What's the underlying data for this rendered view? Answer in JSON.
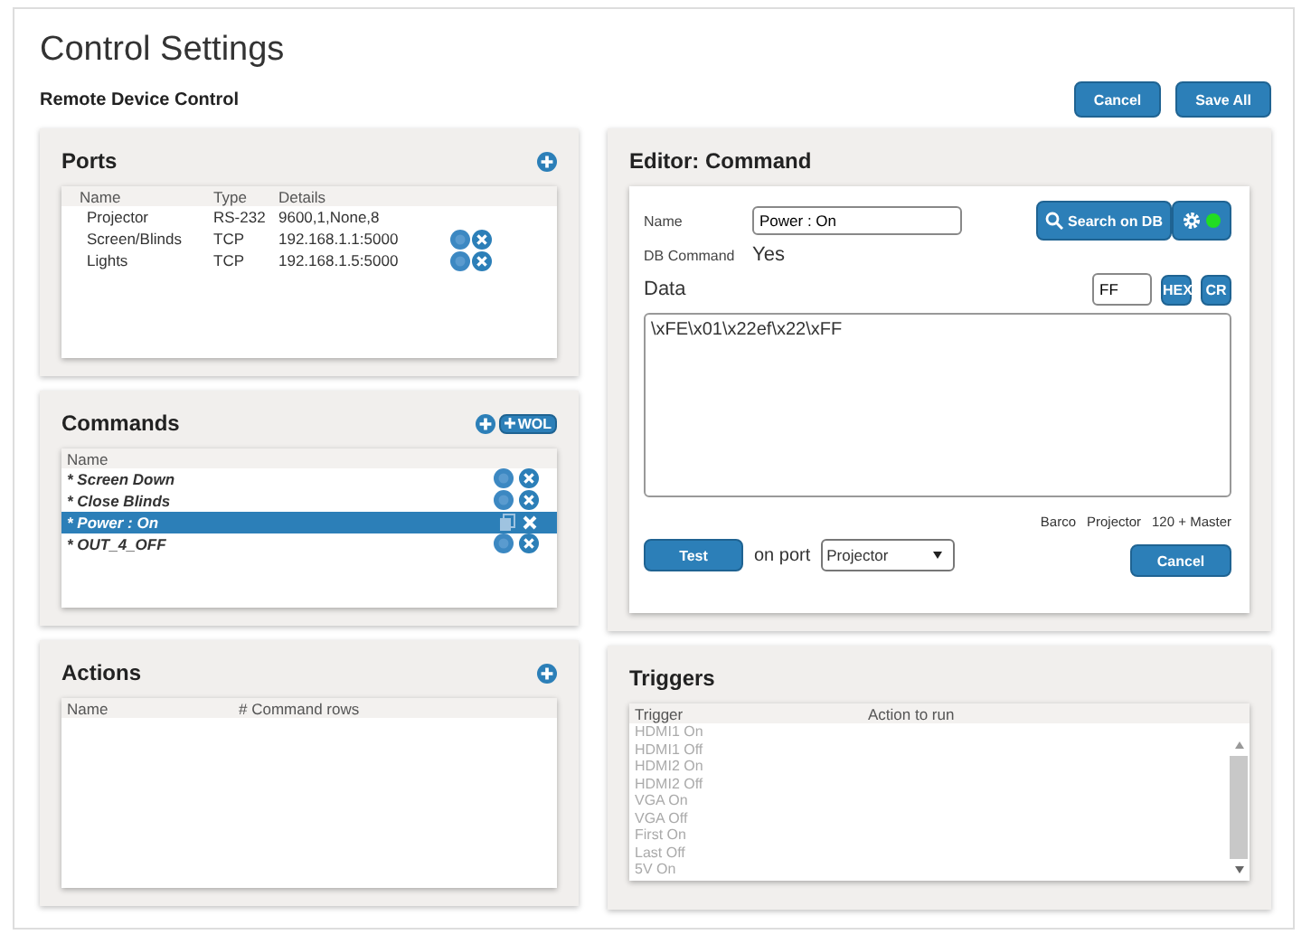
{
  "page": {
    "title": "Control Settings",
    "subtitle": "Remote Device Control",
    "buttons": [
      "Cancel",
      "Save All"
    ]
  },
  "ports": {
    "title": "Ports",
    "columns": [
      "Name",
      "Type",
      "Details"
    ],
    "rows": [
      {
        "name": "Projector",
        "type": "RS-232",
        "details": "9600,1,None,8",
        "has_actions": false
      },
      {
        "name": "Screen/Blinds",
        "type": "TCP",
        "details": "192.168.1.1:5000",
        "has_actions": true
      },
      {
        "name": "Lights",
        "type": "TCP",
        "details": "192.168.1.5:5000",
        "has_actions": true
      }
    ]
  },
  "commands": {
    "title": "Commands",
    "wol_button": "WOL",
    "columns": [
      "Name"
    ],
    "rows": [
      {
        "name": "* Screen Down",
        "selected": false
      },
      {
        "name": "* Close Blinds",
        "selected": false
      },
      {
        "name": "* Power : On",
        "selected": true
      },
      {
        "name": "* OUT_4_OFF",
        "selected": false
      }
    ]
  },
  "actions": {
    "title": "Actions",
    "columns": [
      "Name",
      "# Command rows"
    ]
  },
  "editor": {
    "title": "Editor: Command",
    "name_label": "Name",
    "name_value": "Power : On",
    "search_button": "Search on DB",
    "status_on": true,
    "db_label": "DB Command",
    "db_value": "Yes",
    "data_label": "Data",
    "data_suffix": "FF",
    "hex_button": "HEX",
    "cr_button": "CR",
    "data_value": "\\xFE\\x01\\x22ef\\x22\\xFF",
    "device": [
      "Barco",
      "Projector",
      "120 + Master"
    ],
    "test_button": "Test",
    "port_label": "on port",
    "port_value": "Projector",
    "cancel_button": "Cancel"
  },
  "triggers": {
    "title": "Triggers",
    "columns": [
      "Trigger",
      "Action to run"
    ],
    "rows": [
      {
        "trigger": "HDMI1 On",
        "disabled": true
      },
      {
        "trigger": "HDMI1 Off",
        "disabled": true
      },
      {
        "trigger": "HDMI2 On",
        "disabled": true
      },
      {
        "trigger": "HDMI2 Off",
        "disabled": true
      },
      {
        "trigger": "VGA On",
        "disabled": true
      },
      {
        "trigger": "VGA Off",
        "disabled": true
      },
      {
        "trigger": "First On",
        "disabled": true
      },
      {
        "trigger": "Last Off",
        "disabled": true
      },
      {
        "trigger": "5V On",
        "disabled": true
      }
    ]
  }
}
